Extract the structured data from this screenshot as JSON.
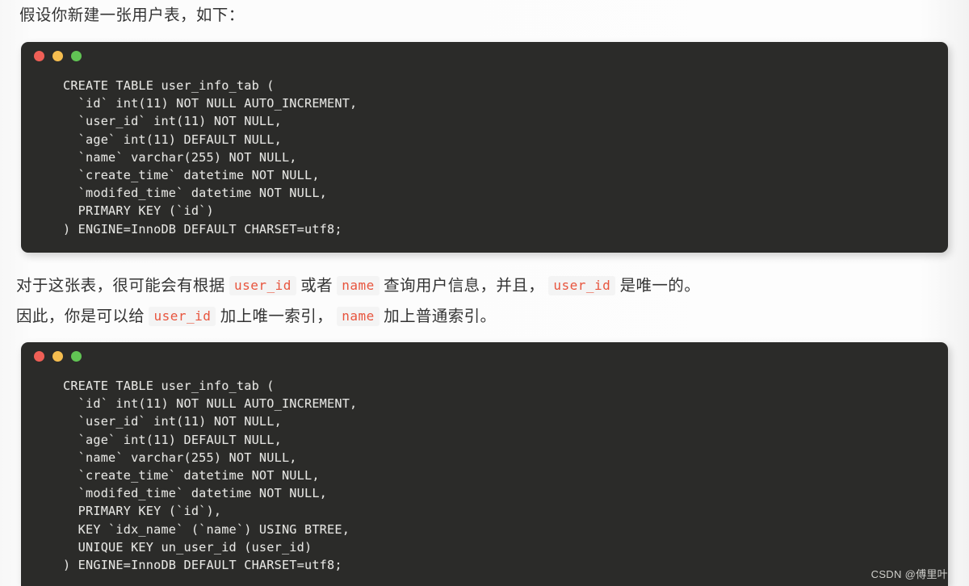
{
  "document": {
    "heading": "假设你新建一张用户表，如下：",
    "paragraph": {
      "line1_part1": "对于这张表，很可能会有根据 ",
      "line1_code1": "user_id",
      "line1_part2": " 或者 ",
      "line1_code2": "name",
      "line1_part3": " 查询用户信息，并且， ",
      "line1_code3": "user_id",
      "line1_part4": " 是唯一的。",
      "line2_part1": "因此，你是可以给 ",
      "line2_code1": "user_id",
      "line2_part2": " 加上唯一索引， ",
      "line2_code2": "name",
      "line2_part3": " 加上普通索引。"
    }
  },
  "code_block_1": {
    "window_dots": [
      "close-red",
      "minimize-yellow",
      "maximize-green"
    ],
    "language": "sql",
    "code": "CREATE TABLE user_info_tab (\n  `id` int(11) NOT NULL AUTO_INCREMENT,\n  `user_id` int(11) NOT NULL,\n  `age` int(11) DEFAULT NULL,\n  `name` varchar(255) NOT NULL,\n  `create_time` datetime NOT NULL,\n  `modifed_time` datetime NOT NULL,\n  PRIMARY KEY (`id`)\n) ENGINE=InnoDB DEFAULT CHARSET=utf8;"
  },
  "code_block_2": {
    "window_dots": [
      "close-red",
      "minimize-yellow",
      "maximize-green"
    ],
    "language": "sql",
    "code": "CREATE TABLE user_info_tab (\n  `id` int(11) NOT NULL AUTO_INCREMENT,\n  `user_id` int(11) NOT NULL,\n  `age` int(11) DEFAULT NULL,\n  `name` varchar(255) NOT NULL,\n  `create_time` datetime NOT NULL,\n  `modifed_time` datetime NOT NULL,\n  PRIMARY KEY (`id`),\n  KEY `idx_name` (`name`) USING BTREE,\n  UNIQUE KEY un_user_id (user_id)\n) ENGINE=InnoDB DEFAULT CHARSET=utf8;"
  },
  "watermark": {
    "text": "CSDN @傅里叶"
  },
  "colors": {
    "page_background": "#fbfbfb",
    "code_background": "#2b2b29",
    "code_text": "#e6e6e3",
    "prose_text": "#333333",
    "inline_code_text": "#e8553e",
    "inline_code_background": "#f4f4f4",
    "dot_red": "#ef5f56",
    "dot_yellow": "#f5bd4f",
    "dot_green": "#61c454"
  }
}
